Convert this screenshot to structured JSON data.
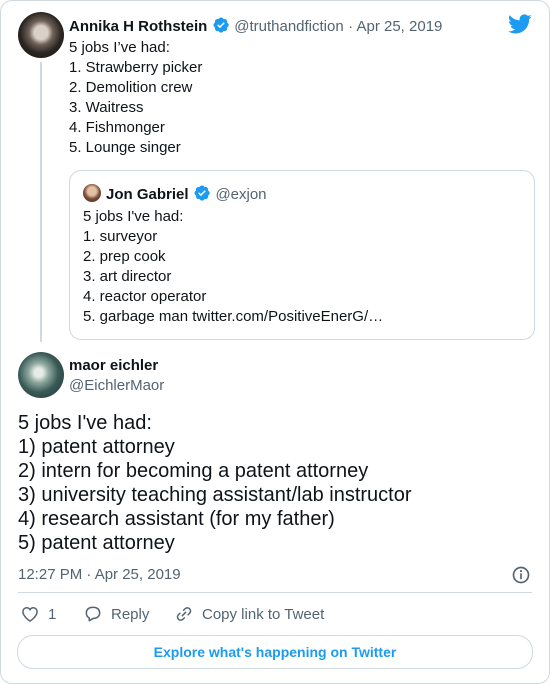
{
  "colors": {
    "accent": "#1d9bf0",
    "text": "#0f1419",
    "muted": "#536471",
    "border": "#cfd9de"
  },
  "quoted_parent": {
    "name": "Annika H Rothstein",
    "handle": "@truthandfiction",
    "date": "· Apr 25, 2019",
    "lines": [
      "5 jobs I’ve had:",
      "1. Strawberry picker",
      "2. Demolition crew",
      "3. Waitress",
      "4. Fishmonger",
      "5. Lounge singer"
    ]
  },
  "quote_tweet": {
    "name": "Jon Gabriel",
    "handle": "@exjon",
    "lines": [
      "5 jobs I've had:",
      "1. surveyor",
      "2. prep cook",
      "3. art director",
      "4. reactor operator",
      "5. garbage man twitter.com/PositiveEnerG/…"
    ]
  },
  "main_tweet": {
    "name": "maor eichler",
    "handle": "@EichlerMaor",
    "lines": [
      "5 jobs I've had:",
      "1) patent attorney",
      "2) intern for becoming a patent attorney",
      "3) university teaching assistant/lab instructor",
      "4) research assistant (for my father)",
      "5) patent attorney"
    ],
    "timestamp": "12:27 PM · Apr 25, 2019"
  },
  "actions": {
    "like_count": "1",
    "reply_label": "Reply",
    "copy_label": "Copy link to Tweet"
  },
  "explore_label": "Explore what's happening on Twitter",
  "icons": [
    "twitter-bird-icon",
    "verified-badge-icon",
    "info-icon",
    "heart-icon",
    "reply-icon",
    "link-icon"
  ]
}
